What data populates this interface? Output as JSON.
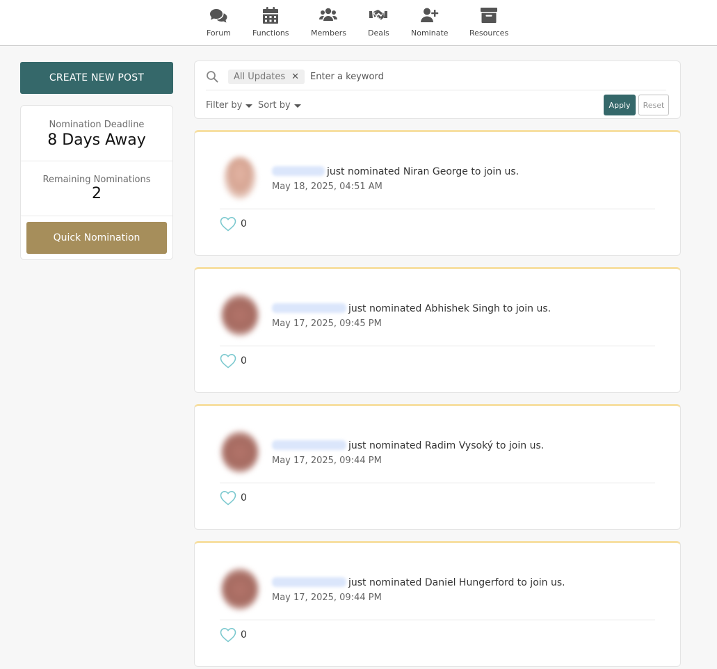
{
  "nav": {
    "items": [
      {
        "label": "Forum",
        "icon": "comments-icon"
      },
      {
        "label": "Functions",
        "icon": "calendar-icon"
      },
      {
        "label": "Members",
        "icon": "users-icon"
      },
      {
        "label": "Deals",
        "icon": "handshake-icon"
      },
      {
        "label": "Nominate",
        "icon": "user-plus-icon"
      },
      {
        "label": "Resources",
        "icon": "archive-box-icon"
      }
    ]
  },
  "sidebar": {
    "create_post_label": "CREATE NEW POST",
    "deadline_label": "Nomination Deadline",
    "deadline_value": "8 Days Away",
    "remaining_label": "Remaining Nominations",
    "remaining_value": "2",
    "quick_nomination_label": "Quick Nomination"
  },
  "search": {
    "chip_label": "All Updates",
    "chip_remove": "✕",
    "placeholder": "Enter a keyword",
    "filter_label": "Filter by",
    "sort_label": "Sort by",
    "apply_label": "Apply",
    "reset_label": "Reset"
  },
  "colors": {
    "primary": "#35686a",
    "gold": "#a68e5b",
    "card_accent": "#f7dfa2",
    "like": "#7cc9cf"
  },
  "posts": [
    {
      "text": "just nominated Niran George to join us.",
      "time": "May 18, 2025, 04:51 AM",
      "likes": "0"
    },
    {
      "text": "just nominated Abhishek Singh to join us.",
      "time": "May 17, 2025, 09:45 PM",
      "likes": "0"
    },
    {
      "text": "just nominated Radim Vysoký to join us.",
      "time": "May 17, 2025, 09:44 PM",
      "likes": "0"
    },
    {
      "text": "just nominated Daniel Hungerford to join us.",
      "time": "May 17, 2025, 09:44 PM",
      "likes": "0"
    }
  ]
}
